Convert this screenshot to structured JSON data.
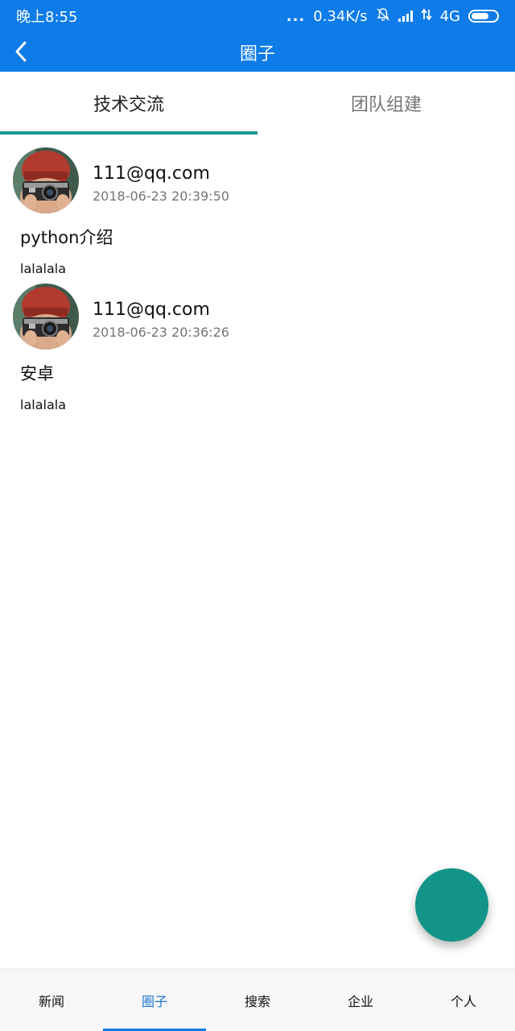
{
  "status_bar": {
    "time": "晚上8:55",
    "dots": "...",
    "speed": "0.34K/s",
    "network": "4G",
    "icons": [
      "bell-off-icon",
      "signal-icon",
      "data-arrows-icon",
      "battery-icon"
    ]
  },
  "app_bar": {
    "title": "圈子",
    "back_icon": "chevron-left-icon"
  },
  "tabs": [
    {
      "label": "技术交流",
      "active": true
    },
    {
      "label": "团队组建",
      "active": false
    }
  ],
  "posts": [
    {
      "author": "111@qq.com",
      "timestamp": "2018-06-23 20:39:50",
      "title": "python介绍",
      "body": "lalalala",
      "avatar_icon": "avatar-photo"
    },
    {
      "author": "111@qq.com",
      "timestamp": "2018-06-23 20:36:26",
      "title": "安卓",
      "body": "lalalala",
      "avatar_icon": "avatar-photo"
    }
  ],
  "bottom_nav": [
    {
      "label": "新闻",
      "active": false
    },
    {
      "label": "圈子",
      "active": true
    },
    {
      "label": "搜索",
      "active": false
    },
    {
      "label": "企业",
      "active": false
    },
    {
      "label": "个人",
      "active": false
    }
  ],
  "colors": {
    "primary": "#0d7be8",
    "tab_indicator": "#1a9a90",
    "fab": "#139488",
    "nav_active": "#1873d3"
  }
}
